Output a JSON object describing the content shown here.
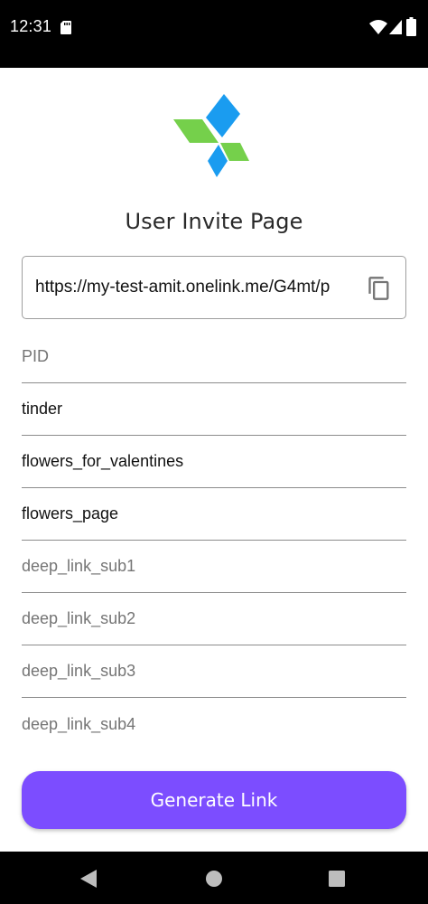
{
  "status_bar": {
    "time": "12:31",
    "icons": [
      "sd-card-icon",
      "wifi-icon",
      "signal-icon",
      "battery-icon"
    ]
  },
  "logo": {
    "name": "app-logo",
    "colors": {
      "green": "#75d04b",
      "blue": "#1a9cf0"
    }
  },
  "page_title": "User Invite Page",
  "invite_link": {
    "url": "https://my-test-amit.onelink.me/G4mt/p",
    "copy_icon": "copy-icon"
  },
  "fields": {
    "pid": {
      "value": "",
      "placeholder": "PID"
    },
    "media_source": {
      "value": "tinder",
      "placeholder": ""
    },
    "campaign": {
      "value": "flowers_for_valentines",
      "placeholder": ""
    },
    "page": {
      "value": "flowers_page",
      "placeholder": ""
    },
    "deep_link_sub1": {
      "value": "",
      "placeholder": "deep_link_sub1"
    },
    "deep_link_sub2": {
      "value": "",
      "placeholder": "deep_link_sub2"
    },
    "deep_link_sub3": {
      "value": "",
      "placeholder": "deep_link_sub3"
    },
    "deep_link_sub4": {
      "value": "",
      "placeholder": "deep_link_sub4"
    }
  },
  "generate_button": {
    "label": "Generate Link",
    "color": "#7c4dff"
  },
  "nav_bar": {
    "icons": [
      "back-icon",
      "home-icon",
      "recents-icon"
    ]
  }
}
